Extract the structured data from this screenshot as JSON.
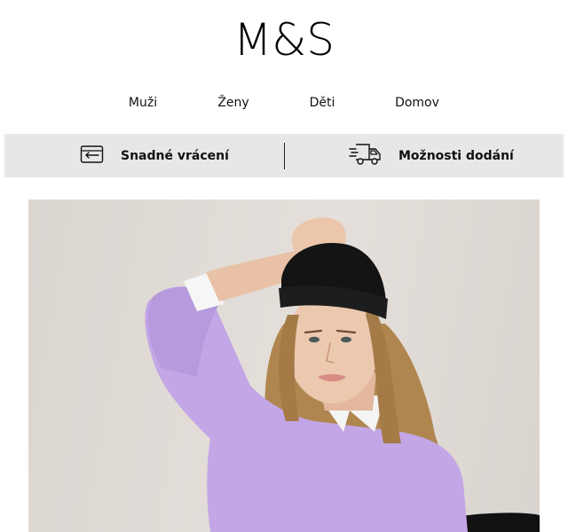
{
  "brand": {
    "logo_text": "M&S"
  },
  "nav": {
    "items": [
      {
        "label": "Muži"
      },
      {
        "label": "Ženy"
      },
      {
        "label": "Děti"
      },
      {
        "label": "Domov"
      }
    ]
  },
  "services": {
    "returns": {
      "label": "Snadné vrácení",
      "icon": "returns-icon"
    },
    "delivery": {
      "label": "Možnosti dodání",
      "icon": "delivery-truck-icon"
    }
  },
  "hero": {
    "subject": "hero-model-image",
    "colors": {
      "sweater": "#c3a6e6",
      "beanie": "#141414",
      "background": "#e0dbd6",
      "hair": "#b08650"
    }
  }
}
